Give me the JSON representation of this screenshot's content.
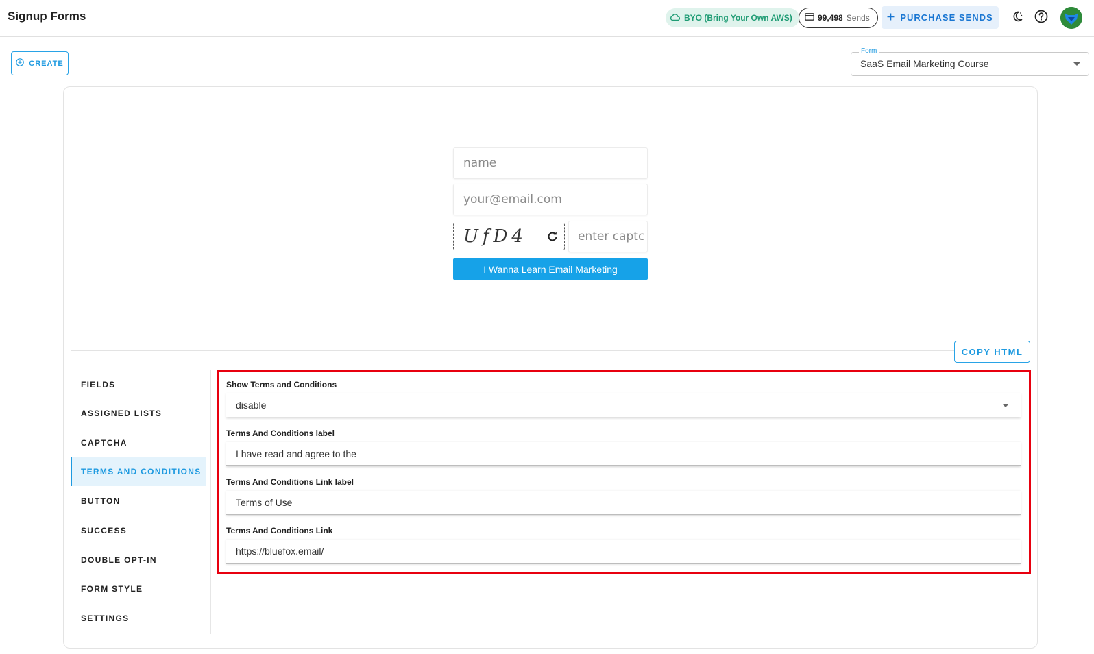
{
  "header": {
    "title": "Signup Forms",
    "byo_label": "BYO (Bring Your Own AWS)",
    "sends_count": "99,498",
    "sends_unit": "Sends",
    "purchase_label": "PURCHASE SENDS"
  },
  "toolbar": {
    "create_label": "CREATE",
    "form_legend": "Form",
    "form_value": "SaaS Email Marketing Course"
  },
  "preview": {
    "name_placeholder": "name",
    "email_placeholder": "your@email.com",
    "captcha_text": "UfD4",
    "captcha_placeholder": "enter captc",
    "submit_label": "I Wanna Learn Email Marketing"
  },
  "copy_html_label": "COPY HTML",
  "tabs": [
    {
      "label": "FIELDS"
    },
    {
      "label": "ASSIGNED LISTS"
    },
    {
      "label": "CAPTCHA"
    },
    {
      "label": "TERMS AND CONDITIONS"
    },
    {
      "label": "BUTTON"
    },
    {
      "label": "SUCCESS"
    },
    {
      "label": "DOUBLE OPT-IN"
    },
    {
      "label": "FORM STYLE"
    },
    {
      "label": "SETTINGS"
    }
  ],
  "active_tab": "TERMS AND CONDITIONS",
  "terms": {
    "show_label": "Show Terms and Conditions",
    "show_value": "disable",
    "label_label": "Terms And Conditions label",
    "label_value": "I have read and agree to the",
    "link_label_label": "Terms And Conditions Link label",
    "link_label_value": "Terms of Use",
    "link_label": "Terms And Conditions Link",
    "link_value": "https://bluefox.email/"
  },
  "colors": {
    "accent": "#1e9ae0",
    "byo_bg": "#dff3ec",
    "byo_text": "#1f9c74",
    "highlight": "#e8000f"
  }
}
